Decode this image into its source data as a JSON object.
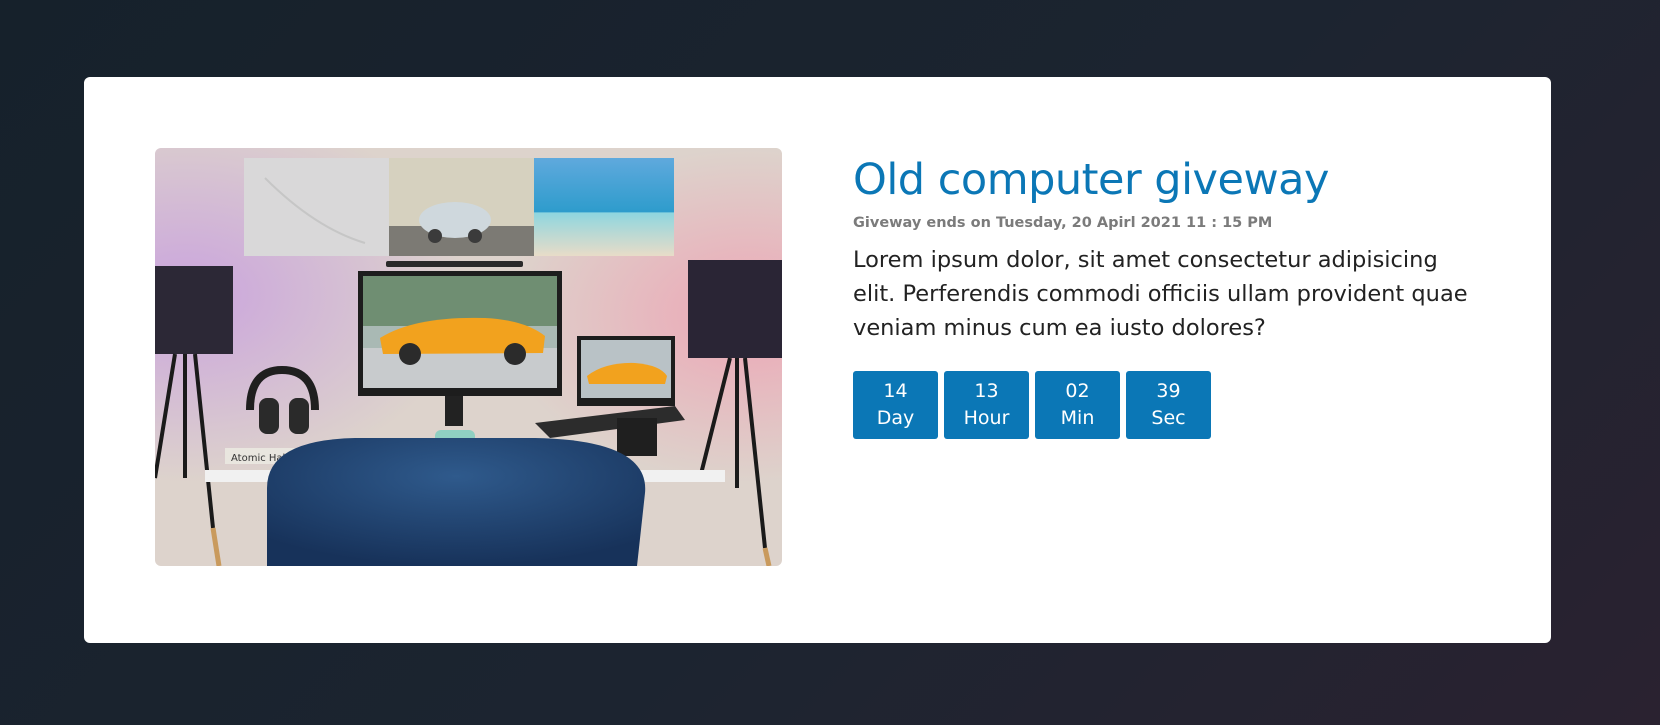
{
  "giveaway": {
    "image_alt": "Desk setup with monitor and laptop showing a yellow sports car",
    "image_book_text": "Atomic Habits",
    "title": "Old computer giveway",
    "ends_text": "Giveway ends on Tuesday, 20 Apirl 2021 11 : 15 PM",
    "description": "Lorem ipsum dolor, sit amet consectetur adipisicing elit. Perferendis commodi officiis ullam provident quae veniam minus cum ea iusto dolores?",
    "countdown": [
      {
        "value": "14",
        "unit": "Day"
      },
      {
        "value": "13",
        "unit": "Hour"
      },
      {
        "value": "02",
        "unit": "Min"
      },
      {
        "value": "39",
        "unit": "Sec"
      }
    ]
  },
  "colors": {
    "accent": "#0b77b6",
    "card": "#ffffff",
    "meta_text": "#7b7b7b",
    "body_text": "#222222",
    "page_bg": "#1a222c"
  }
}
